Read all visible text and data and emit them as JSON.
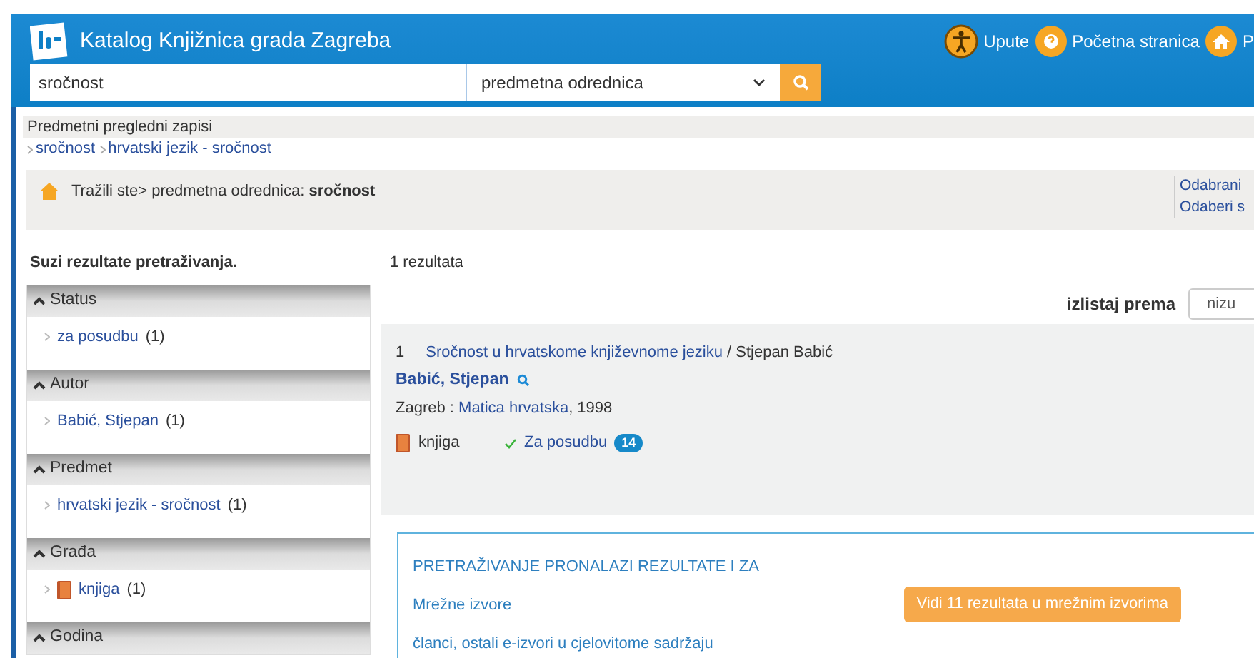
{
  "header": {
    "title": "Katalog Knjižnica grada Zagreba",
    "links": [
      {
        "kind": "accessibility",
        "label": "Upute"
      },
      {
        "kind": "help",
        "label": "Početna stranica"
      },
      {
        "kind": "home",
        "label": "P"
      }
    ]
  },
  "search": {
    "value": "sročnost",
    "field": "predmetna odrednica"
  },
  "subject_records": {
    "title": "Predmetni pregledni zapisi",
    "links": [
      "sročnost",
      "hrvatski jezik - sročnost"
    ]
  },
  "query": {
    "text": "Tražili ste> predmetna odrednica: **sročnost**",
    "links": [
      "Odabrani",
      "Odaberi s"
    ]
  },
  "facets": {
    "title": "Suzi rezultate pretraživanja.",
    "groups": [
      {
        "name": "Status",
        "expanded": true,
        "items": [
          {
            "kind": "plain",
            "label": "za posudbu",
            "count": "(1)"
          }
        ]
      },
      {
        "name": "Autor",
        "expanded": true,
        "items": [
          {
            "kind": "plain",
            "label": "Babić, Stjepan",
            "count": "(1)"
          }
        ]
      },
      {
        "name": "Predmet",
        "expanded": true,
        "items": [
          {
            "kind": "plain",
            "label": "hrvatski jezik - sročnost",
            "count": "(1)"
          }
        ]
      },
      {
        "name": "Građa",
        "expanded": true,
        "items": [
          {
            "kind": "book",
            "label": "knjiga",
            "count": "(1)"
          }
        ]
      },
      {
        "name": "Godina",
        "expanded": true
      }
    ]
  },
  "results": {
    "count": "1 rezultata",
    "sort_label": "izlistaj prema",
    "sort_value": "nizu",
    "items": [
      {
        "number": "1",
        "title": "Sročnost u hrvatskome književnome jeziku",
        "responsibility": " / Stjepan Babić",
        "author": "Babić, Stjepan",
        "place": "Zagreb : ",
        "publisher": "Matica hrvatska",
        "year": ", 1998",
        "material": "knjiga",
        "availability": "Za posudbu",
        "copies": "14"
      }
    ]
  },
  "online": {
    "heading": "PRETRAŽIVANJE PRONALAZI REZULTATE I ZA",
    "lines": [
      "Mrežne izvore",
      "članci, ostali e-izvori u cjelovitome sadržaju"
    ],
    "button": "Vidi 11 rezultata u mrežnim izvorima"
  }
}
